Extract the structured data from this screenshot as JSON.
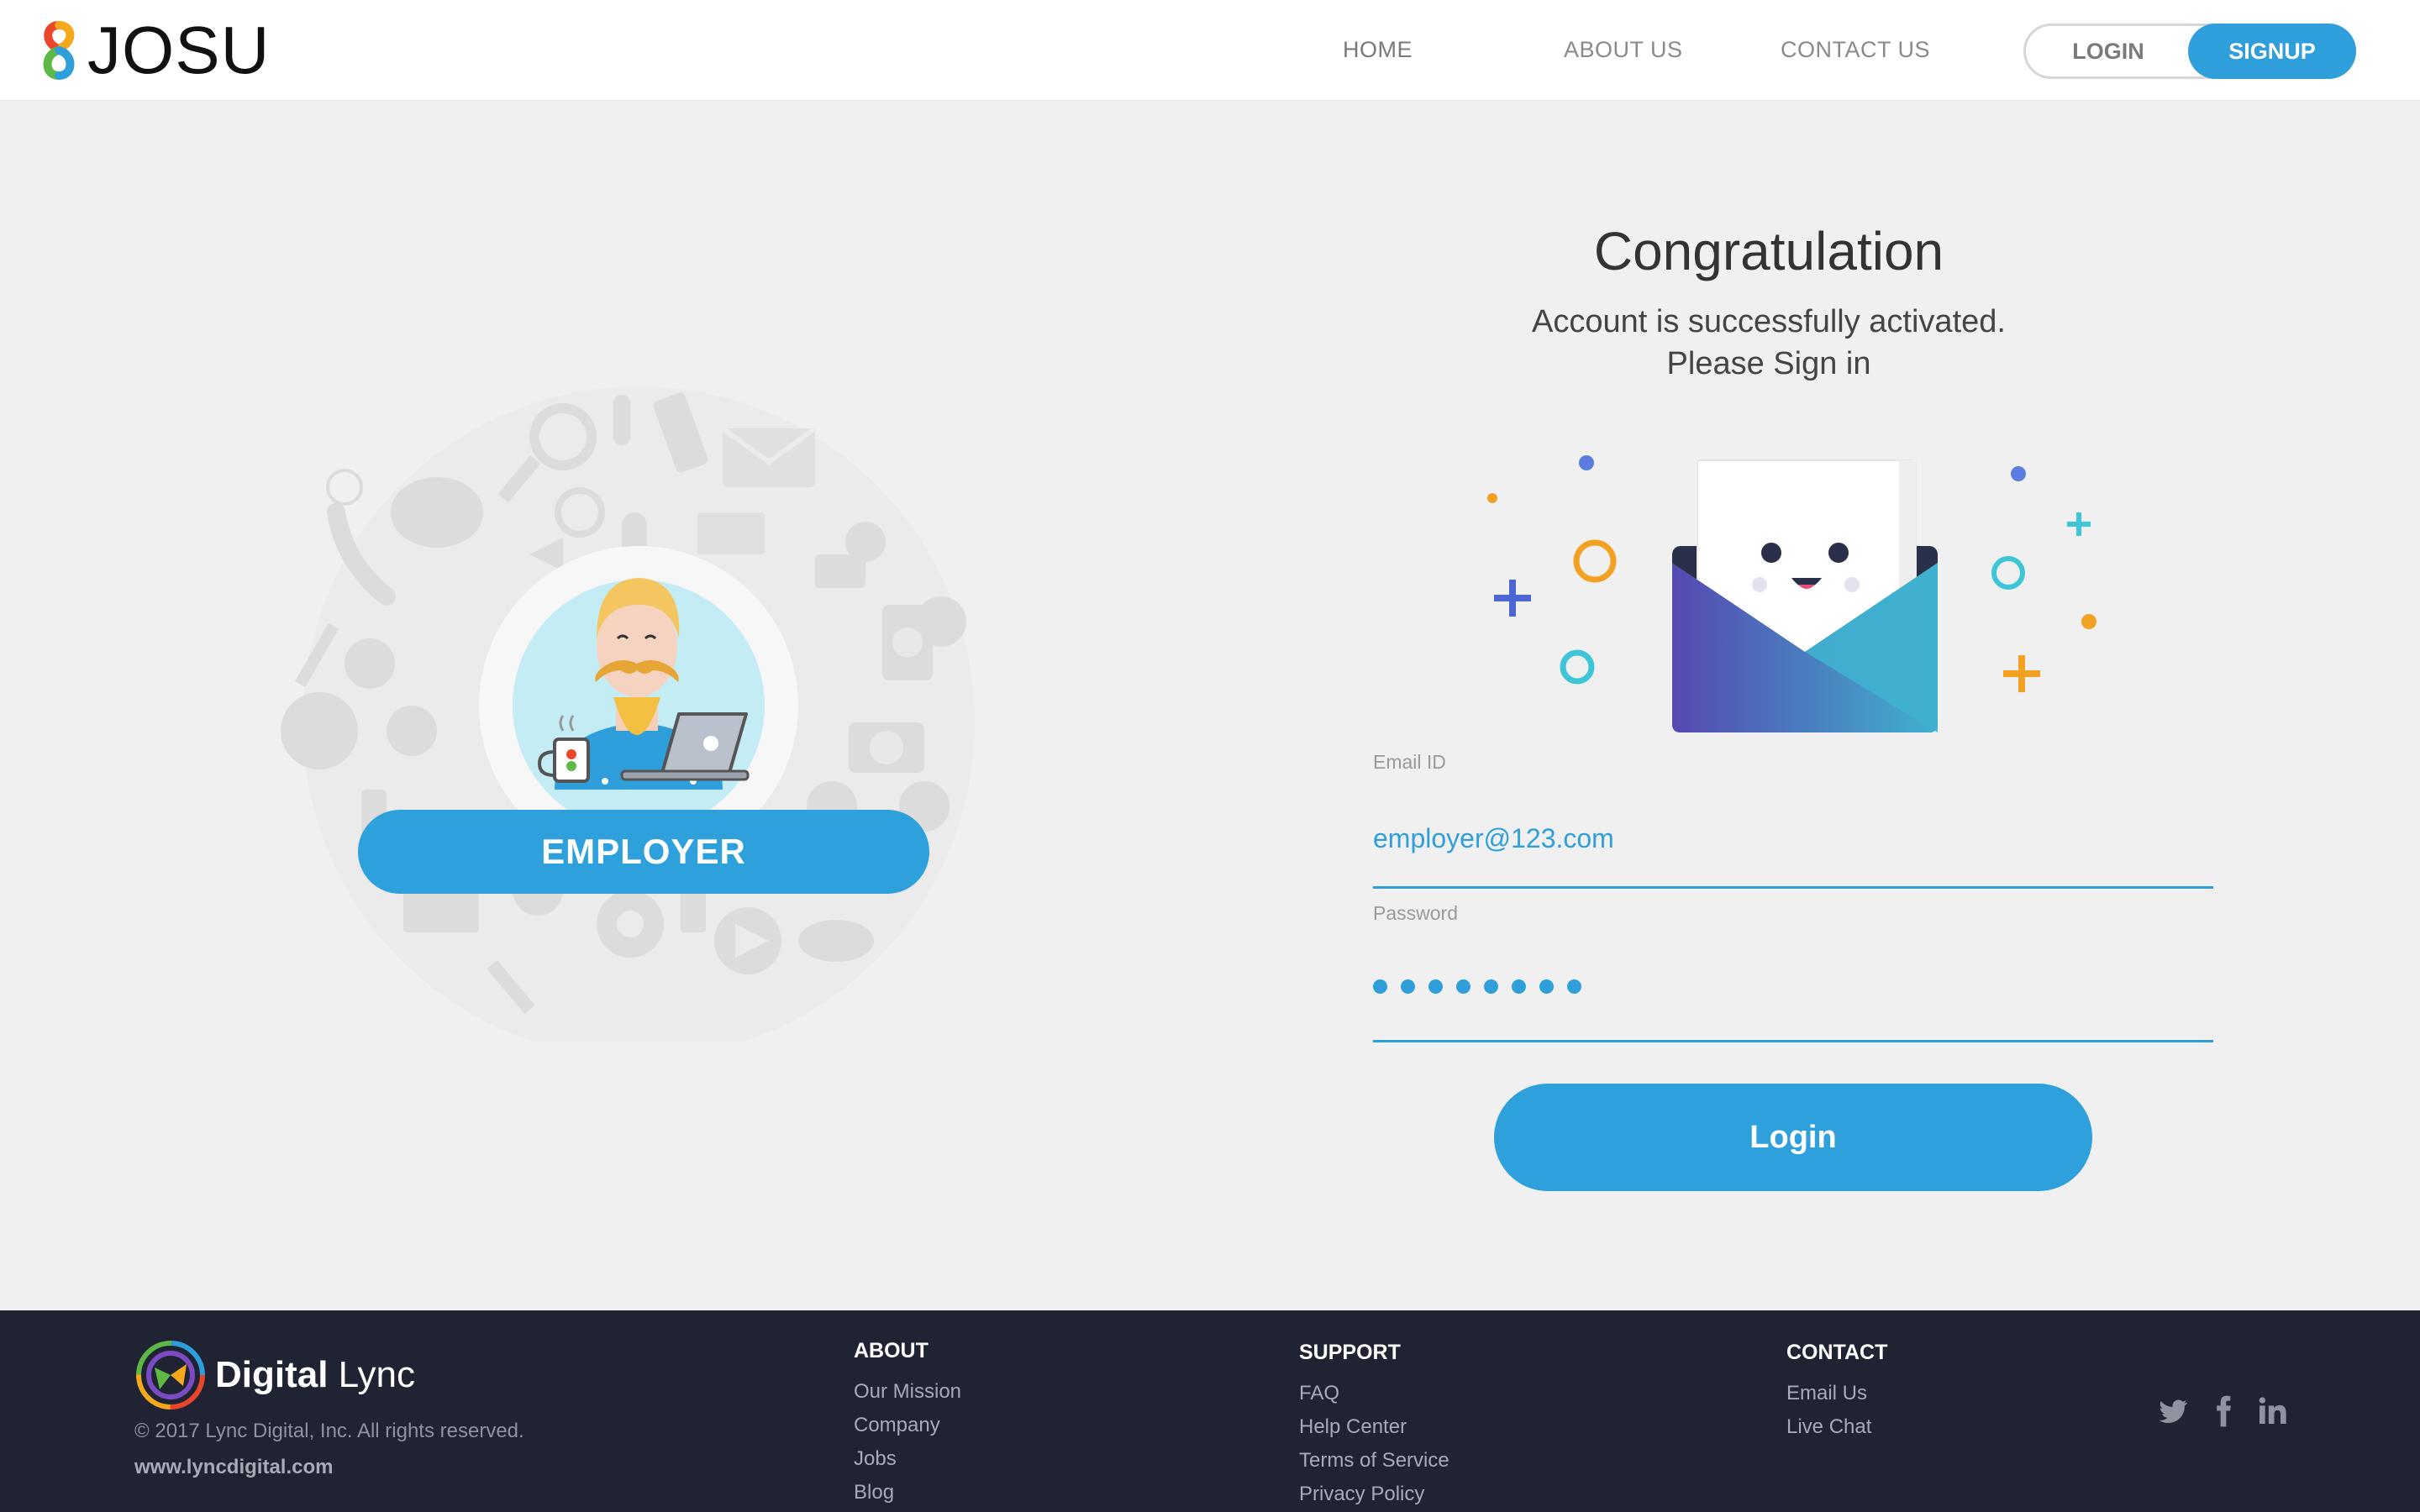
{
  "header": {
    "logo_text": "JOSU",
    "nav": {
      "home": "HOME",
      "about": "ABOUT US",
      "contact": "CONTACT US"
    },
    "login_label": "LOGIN",
    "signup_label": "SIGNUP"
  },
  "left": {
    "role_label": "EMPLOYER"
  },
  "main": {
    "title": "Congratulation",
    "subtitle_line1": "Account is successfully activated.",
    "subtitle_line2": "Please Sign in",
    "email_label": "Email ID",
    "email_value": "employer@123.com",
    "password_label": "Password",
    "password_mask_count": 8,
    "login_button": "Login"
  },
  "footer": {
    "brand_bold": "Digital",
    "brand_light": " Lync",
    "copyright": "© 2017 Lync Digital, Inc. All rights reserved.",
    "website": "www.lyncdigital.com",
    "about": {
      "heading": "ABOUT",
      "links": [
        "Our Mission",
        "Company",
        "Jobs",
        "Blog"
      ]
    },
    "support": {
      "heading": "SUPPORT",
      "links": [
        "FAQ",
        "Help Center",
        "Terms of Service",
        "Privacy Policy"
      ]
    },
    "contact": {
      "heading": "CONTACT",
      "links": [
        "Email Us",
        "Live Chat"
      ]
    },
    "social": [
      "twitter-icon",
      "facebook-icon",
      "linkedin-icon"
    ]
  },
  "colors": {
    "accent": "#2e9fdb",
    "footer_bg": "#1f2332",
    "page_bg": "#f0f0f0"
  }
}
